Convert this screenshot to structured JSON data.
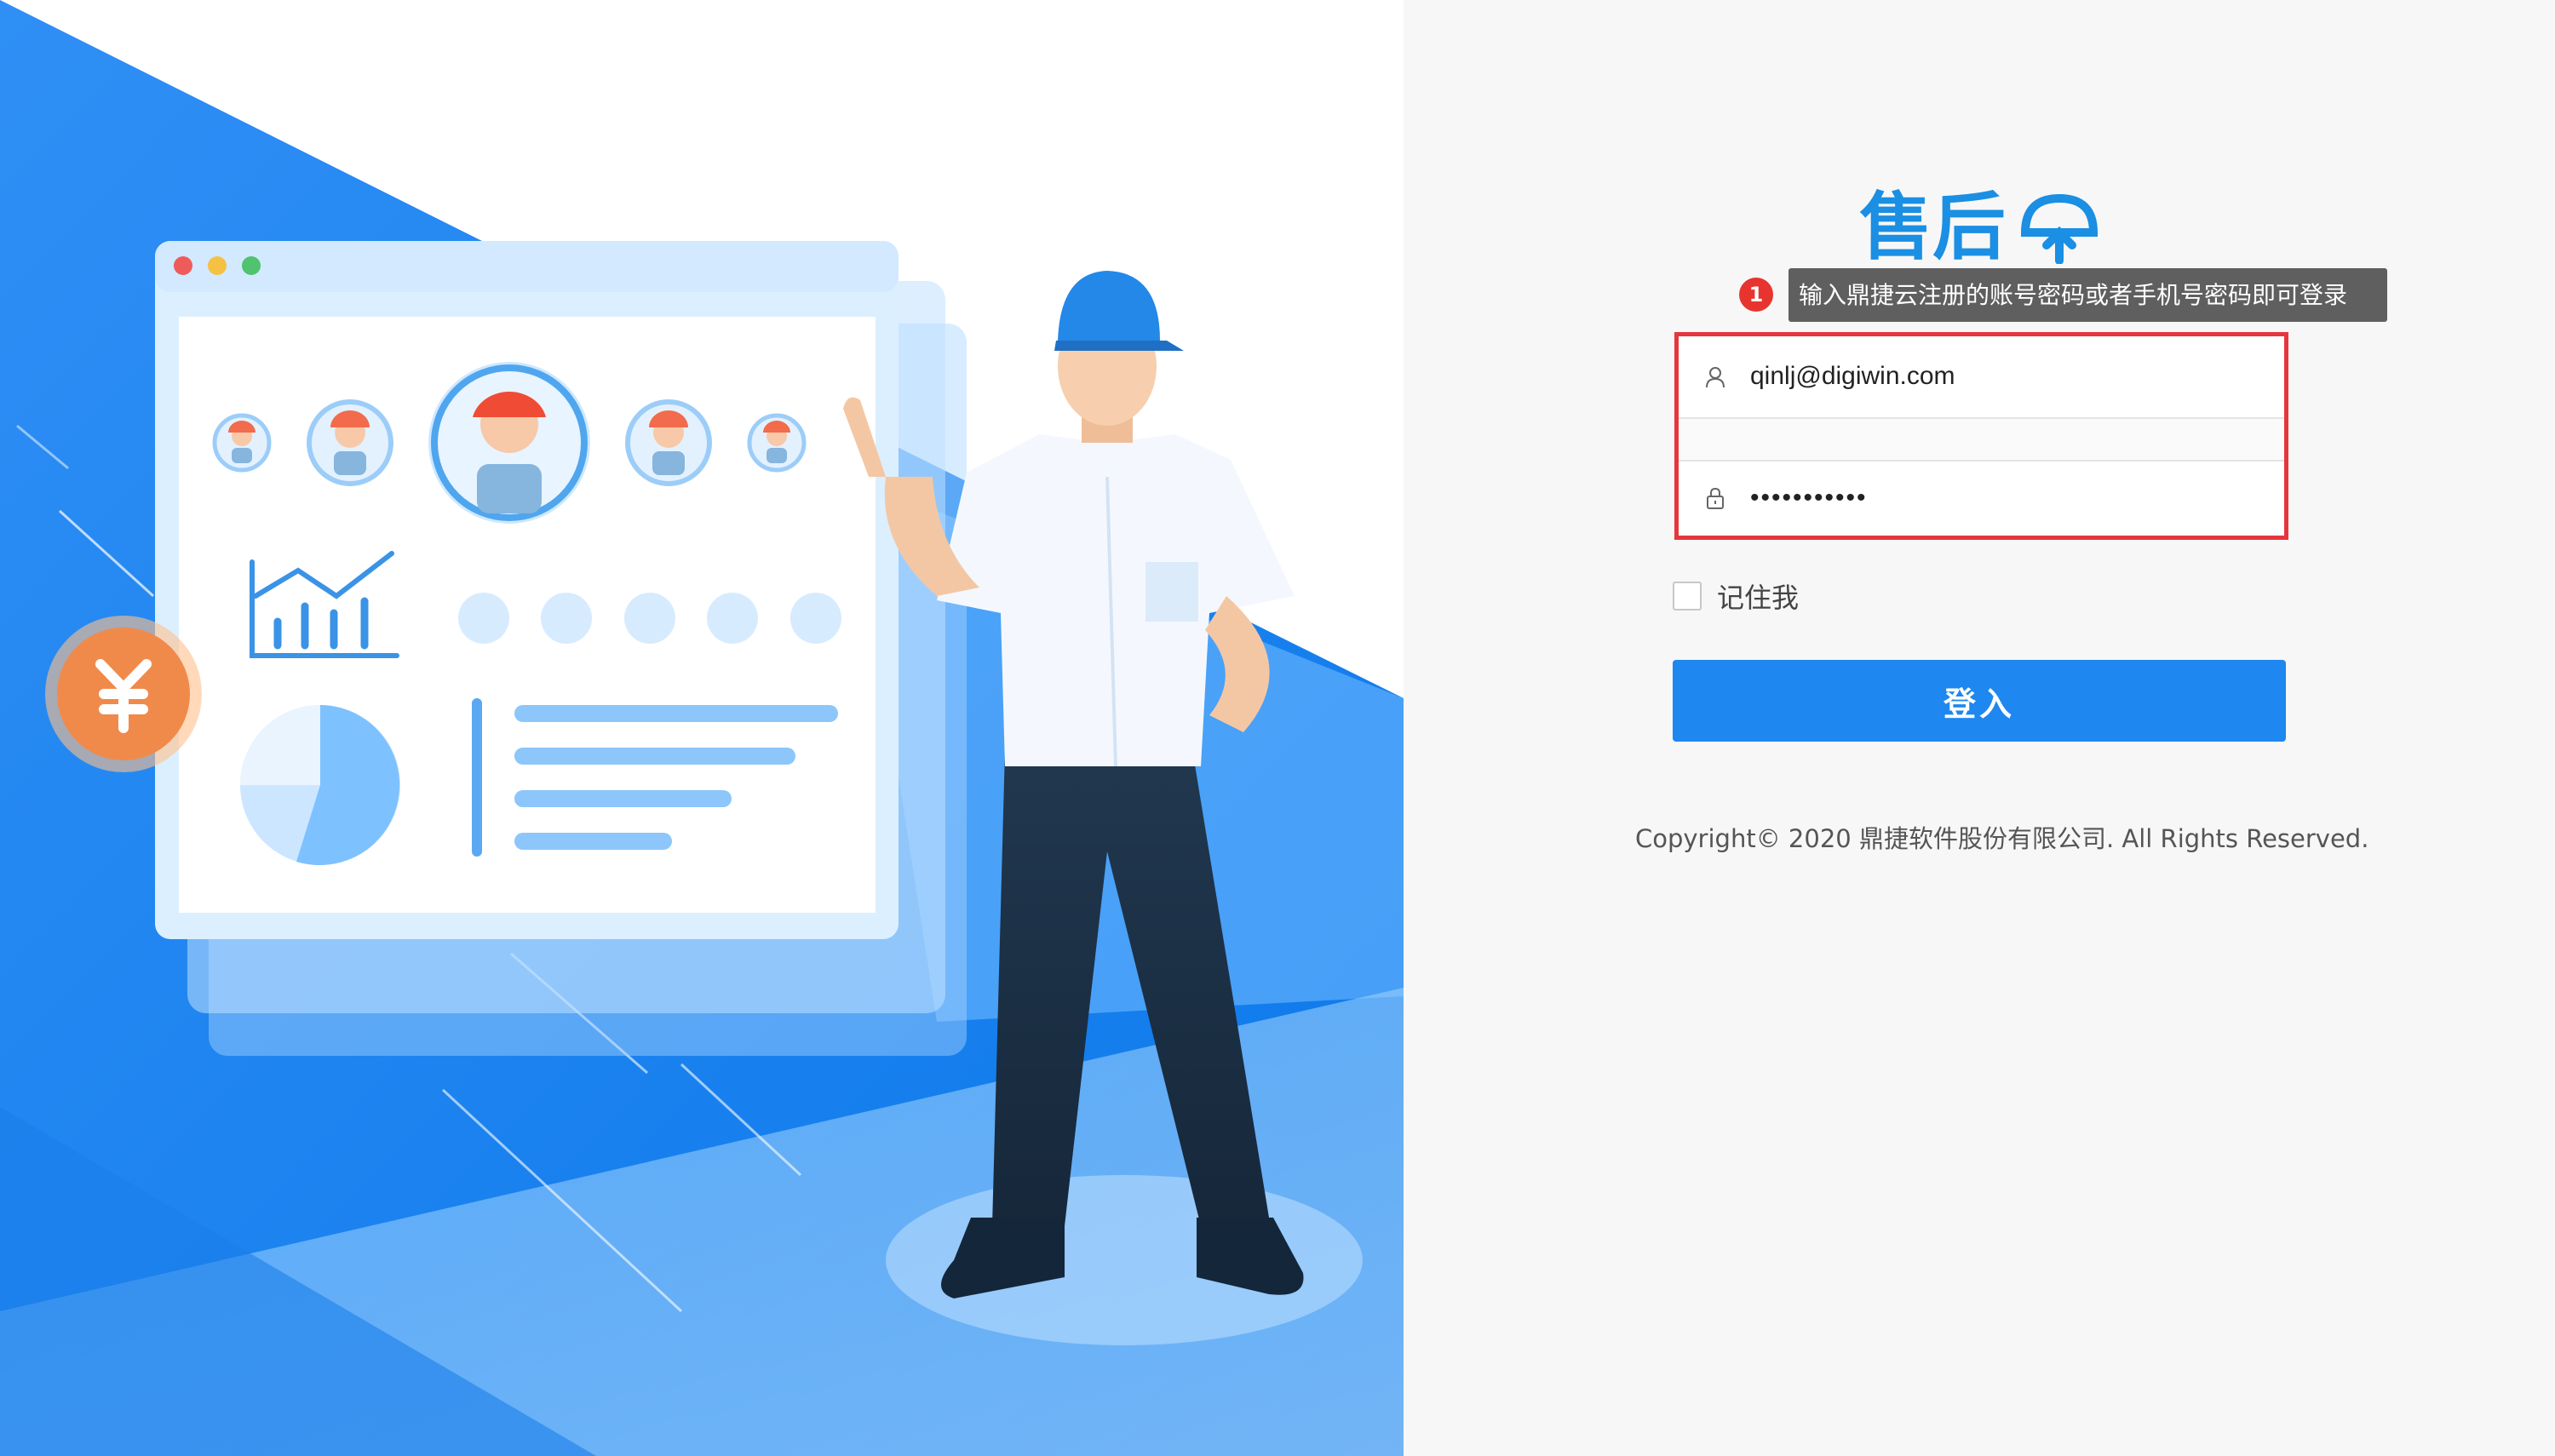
{
  "brand": {
    "logo_text": "售后",
    "accent_color": "#1a8fe3"
  },
  "tooltip": {
    "badge": "1",
    "text": "输入鼎捷云注册的账号密码或者手机号密码即可登录"
  },
  "form": {
    "username_value": "qinlj@digiwin.com",
    "password_value": "•••••••••••",
    "remember_label": "记住我",
    "remember_checked": false,
    "submit_label": "登入"
  },
  "footer": {
    "copyright": "Copyright© 2020 鼎捷软件股份有限公司. All Rights Reserved."
  },
  "colors": {
    "primary_button": "#1e87f0",
    "highlight_border": "#e5363d",
    "tooltip_bg": "#5f5f5f",
    "badge_bg": "#e8342f",
    "panel_bg": "#f7f7f7"
  },
  "illustration": {
    "subject": "worker-presenting-dashboard",
    "icons": [
      "avatar-icon",
      "bar-chart-icon",
      "pie-chart-icon",
      "yen-coin-icon"
    ]
  }
}
